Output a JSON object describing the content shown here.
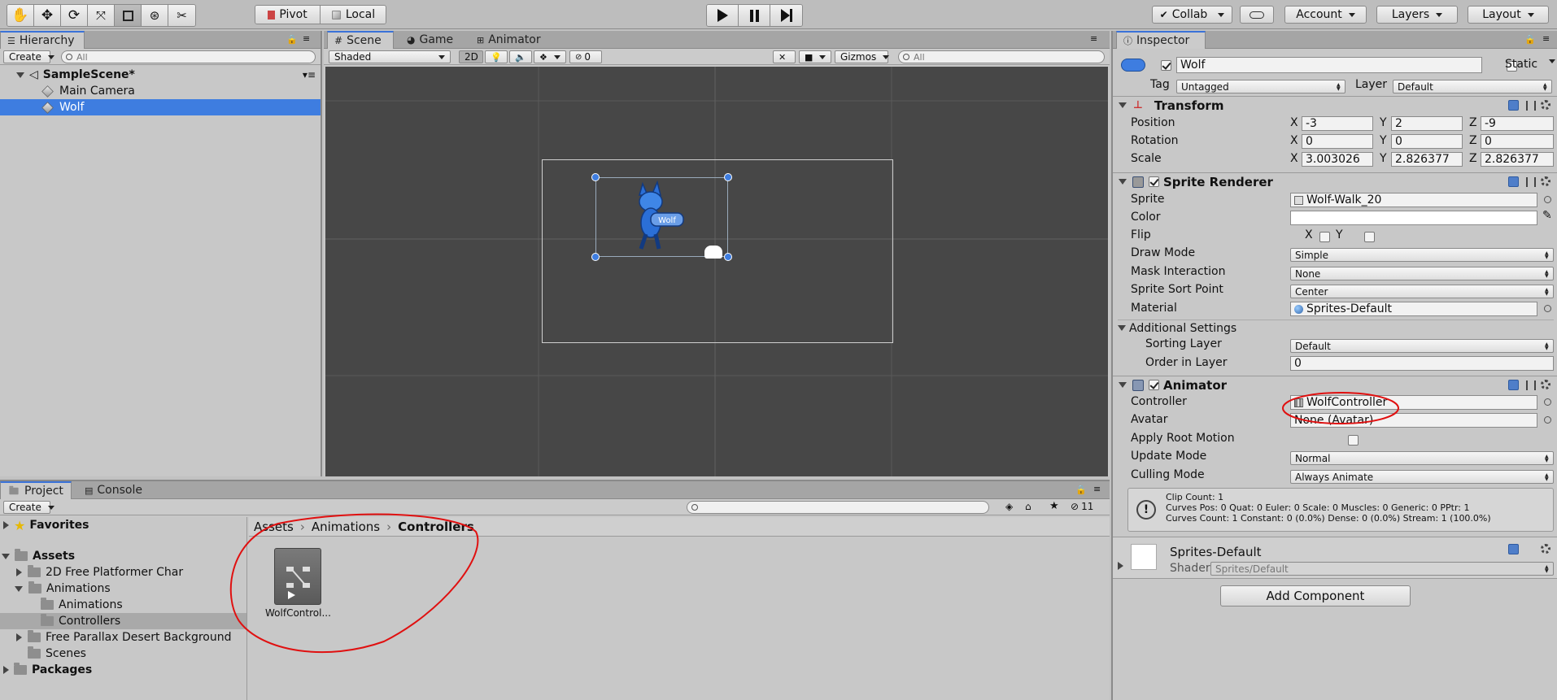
{
  "toolbar": {
    "pivot": "Pivot",
    "local": "Local",
    "collab": "Collab",
    "account": "Account",
    "layers": "Layers",
    "layout": "Layout"
  },
  "hierarchy": {
    "tab": "Hierarchy",
    "create": "Create",
    "search_placeholder": "All",
    "scene": "SampleScene*",
    "items": [
      "Main Camera",
      "Wolf"
    ]
  },
  "scene_tabs": {
    "scene": "Scene",
    "game": "Game",
    "animator": "Animator"
  },
  "scene_bar": {
    "shading": "Shaded",
    "mode2d": "2D",
    "hidden_count": "0",
    "gizmos": "Gizmos",
    "search_placeholder": "All"
  },
  "scene_view": {
    "sprite_label": "Wolf"
  },
  "project": {
    "tab": "Project",
    "console_tab": "Console",
    "create": "Create",
    "favorites": "Favorites",
    "assets": "Assets",
    "tree": [
      "2D Free Platformer Char",
      "Animations",
      "Animations",
      "Controllers",
      "Free Parallax Desert Background",
      "Scenes"
    ],
    "packages": "Packages",
    "breadcrumb": [
      "Assets",
      "Animations",
      "Controllers"
    ],
    "asset_name": "WolfControl...",
    "count": "11"
  },
  "inspector": {
    "tab": "Inspector",
    "object_name": "Wolf",
    "static_label": "Static",
    "tag_label": "Tag",
    "tag_value": "Untagged",
    "layer_label": "Layer",
    "layer_value": "Default",
    "transform": {
      "title": "Transform",
      "position": "Position",
      "rotation": "Rotation",
      "scale": "Scale",
      "x": "X",
      "y": "Y",
      "z": "Z",
      "pos": [
        "-3",
        "2",
        "-9"
      ],
      "rot": [
        "0",
        "0",
        "0"
      ],
      "scl": [
        "3.003026",
        "2.826377",
        "2.826377"
      ]
    },
    "sprite_renderer": {
      "title": "Sprite Renderer",
      "sprite_label": "Sprite",
      "sprite_value": "Wolf-Walk_20",
      "color_label": "Color",
      "flip_label": "Flip",
      "flip_x": "X",
      "flip_y": "Y",
      "draw_mode_label": "Draw Mode",
      "draw_mode_value": "Simple",
      "mask_label": "Mask Interaction",
      "mask_value": "None",
      "sort_point_label": "Sprite Sort Point",
      "sort_point_value": "Center",
      "material_label": "Material",
      "material_value": "Sprites-Default",
      "additional": "Additional Settings",
      "sorting_layer_label": "Sorting Layer",
      "sorting_layer_value": "Default",
      "order_label": "Order in Layer",
      "order_value": "0"
    },
    "animator": {
      "title": "Animator",
      "controller_label": "Controller",
      "controller_value": "WolfController",
      "avatar_label": "Avatar",
      "avatar_value": "None (Avatar)",
      "root_motion_label": "Apply Root Motion",
      "update_mode_label": "Update Mode",
      "update_mode_value": "Normal",
      "culling_label": "Culling Mode",
      "culling_value": "Always Animate",
      "info": [
        "Clip Count: 1",
        "Curves Pos: 0 Quat: 0 Euler: 0 Scale: 0 Muscles: 0 Generic: 0 PPtr: 1",
        "Curves Count: 1 Constant: 0 (0.0%) Dense: 0 (0.0%) Stream: 1 (100.0%)"
      ]
    },
    "material": {
      "name": "Sprites-Default",
      "shader_label": "Shader",
      "shader_value": "Sprites/Default"
    },
    "add_component": "Add Component"
  },
  "colors": {
    "selection": "#3e7de0",
    "annotation": "#e01010",
    "scene_bg": "#474747"
  }
}
